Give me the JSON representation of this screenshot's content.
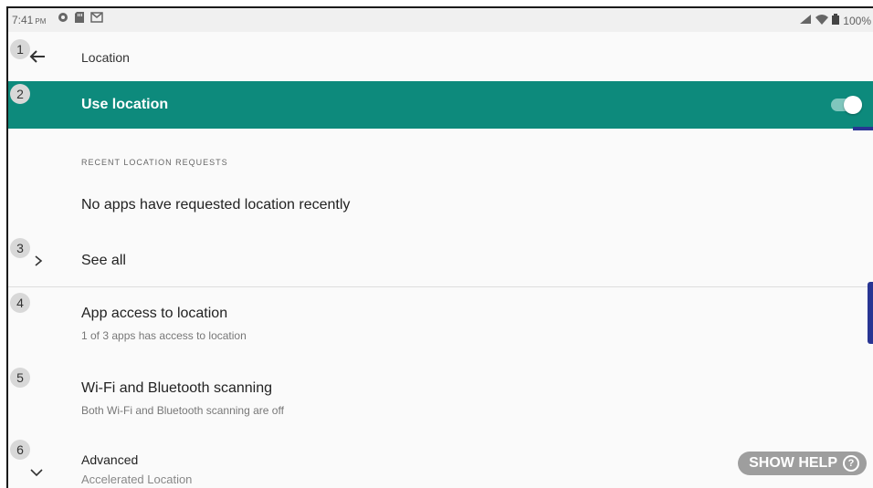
{
  "status_bar": {
    "time": "7:41",
    "ampm": "PM",
    "icons": [
      "alarm-icon",
      "sd-card-icon",
      "mail-icon"
    ],
    "battery": "100%"
  },
  "app_bar": {
    "title": "Location"
  },
  "badges": [
    "1",
    "2",
    "3",
    "4",
    "5",
    "6"
  ],
  "master_switch": {
    "label": "Use location",
    "on": true
  },
  "recent": {
    "header": "RECENT LOCATION REQUESTS",
    "empty_text": "No apps have requested location recently",
    "see_all": "See all"
  },
  "prefs": [
    {
      "title": "App access to location",
      "summary": "1 of 3 apps has access to location"
    },
    {
      "title": "Wi-Fi and Bluetooth scanning",
      "summary": "Both Wi-Fi and Bluetooth scanning are off"
    },
    {
      "title": "Advanced",
      "summary": "Accelerated Location"
    }
  ],
  "help": {
    "label": "SHOW HELP",
    "icon_glyph": "?"
  },
  "colors": {
    "accent": "#0d8a7c",
    "side_tab": "#283593"
  }
}
